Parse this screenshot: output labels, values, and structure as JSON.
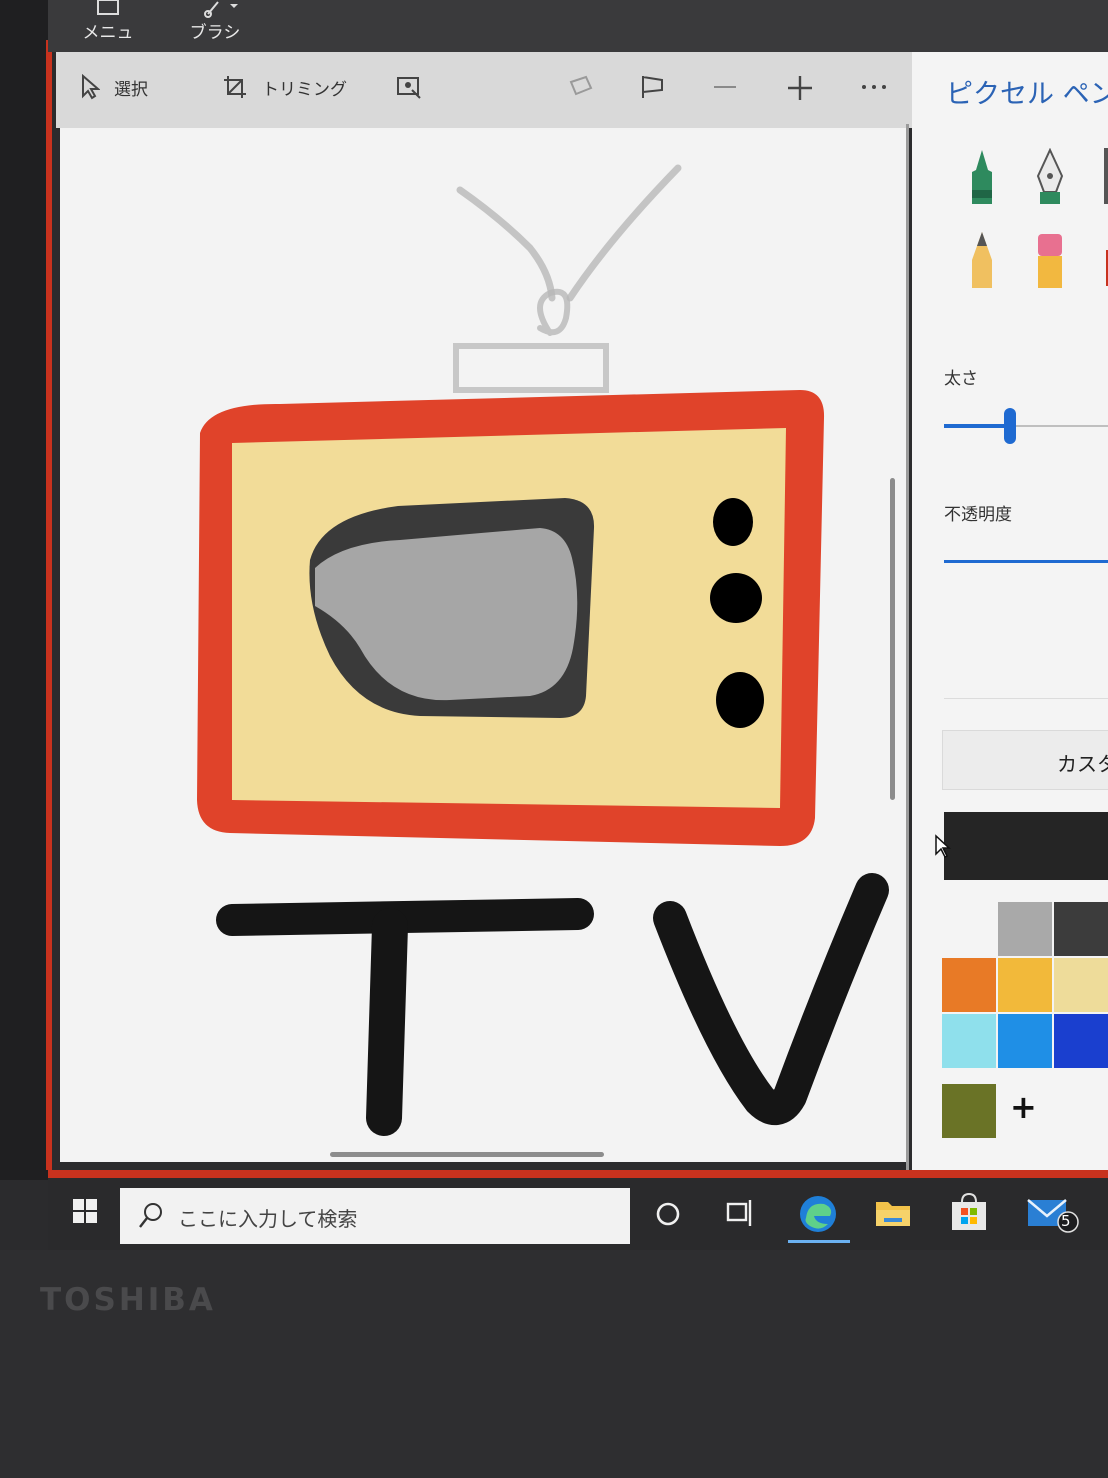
{
  "menubar": {
    "menu_label": "メニュー",
    "brush_label": "ブラシ"
  },
  "toolbar": {
    "select_label": "選択",
    "trim_label": "トリミング"
  },
  "panel": {
    "title": "ピクセル ペン",
    "thickness_label": "太さ",
    "thickness_value": 0.4,
    "opacity_label": "不透明度",
    "opacity_value": 1.0,
    "custom_label": "カスタ",
    "add_color": "+",
    "current_color": "#252525",
    "swatches": [
      "#f4f4f4",
      "#a9a9a9",
      "#3c3c3c",
      "#e87a26",
      "#f2b93a",
      "#eedc9a",
      "#8fe0ec",
      "#1f8fe6",
      "#1a3fcf",
      "#6a7326"
    ]
  },
  "canvas_drawing": {
    "text": "TV",
    "colors": {
      "frame": "#e0432a",
      "body": "#f2dc98",
      "screen_border": "#3a3a3a",
      "screen": "#a6a6a6",
      "ink": "#151515",
      "antenna": "#b8b8b8"
    }
  },
  "taskbar": {
    "search_placeholder": "ここに入力して検索",
    "mail_badge": "5"
  },
  "brand": "TOSHIBA"
}
